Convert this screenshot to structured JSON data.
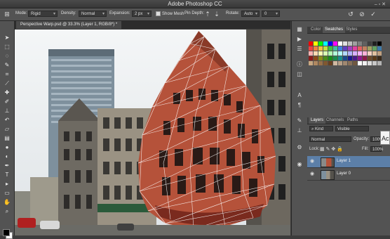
{
  "app": {
    "title": "Adobe Photoshop CC"
  },
  "options": {
    "mode_label": "Mode:",
    "mode_value": "Rigid",
    "density_label": "Density:",
    "density_value": "Normal",
    "expansion_label": "Expansion:",
    "expansion_value": "2 px",
    "show_mesh_label": "Show Mesh",
    "pin_depth_label": "Pin Depth:",
    "rotate_label": "Rotate:",
    "rotate_value": "Auto",
    "rotate_angle": "0"
  },
  "document": {
    "tab_label": "Perspective Warp.psd @ 33.3% (Layer 1, RGB/8*) *"
  },
  "swatches_panel": {
    "tabs": [
      "Color",
      "Swatches",
      "Styles"
    ],
    "active_tab": "Swatches",
    "colors": [
      "#ff0000",
      "#ffff00",
      "#00ff00",
      "#00ffff",
      "#0000ff",
      "#ff00ff",
      "#ffffff",
      "#e0e0e0",
      "#c0c0c0",
      "#a0a0a0",
      "#808080",
      "#606060",
      "#404040",
      "#202020",
      "#000000",
      "#f04040",
      "#f08040",
      "#f0c040",
      "#c0e040",
      "#40c040",
      "#40c0a0",
      "#4080e0",
      "#6040c0",
      "#a040c0",
      "#e040a0",
      "#e06060",
      "#c08060",
      "#a0a060",
      "#60a060",
      "#3d7aa8",
      "#ffb3b3",
      "#ffd9b3",
      "#ffffb3",
      "#d9ffb3",
      "#b3ffb3",
      "#b3ffd9",
      "#b3ffff",
      "#b3d9ff",
      "#b3b3ff",
      "#d9b3ff",
      "#ffb3ff",
      "#ffb3d9",
      "#f5d0c0",
      "#e0c0a0",
      "#c0a080",
      "#8c1a1a",
      "#8c4a1a",
      "#8c8c1a",
      "#4a8c1a",
      "#1a8c1a",
      "#1a8c4a",
      "#1a8c8c",
      "#1a4a8c",
      "#1a1a8c",
      "#4a1a8c",
      "#8c1a8c",
      "#8c1a4a",
      "#6b4a2a",
      "#5a3a1a",
      "#3a2a1a",
      "#c8a882",
      "#b08860",
      "#987048",
      "#805830",
      "#684020",
      "#d0b8a0",
      "#b8a088",
      "#a08870",
      "#887058",
      "#705840",
      "#ffffff",
      "#f0f0f0",
      "#dcdcdc",
      "#c8c8c8",
      "#b4b4b4"
    ]
  },
  "layers_panel": {
    "tabs": [
      "Layers",
      "Channels",
      "Paths"
    ],
    "active_tab": "Layers",
    "kind_filter": "Kind",
    "filter_value": "Visible",
    "blend_mode": "Normal",
    "opacity_label": "Opacity:",
    "opacity_value": "100%",
    "fill_label": "Fill:",
    "fill_value": "100%",
    "lock_label": "Lock:",
    "layers": [
      {
        "name": "Layer 1",
        "selected": true
      },
      {
        "name": "Layer 0",
        "selected": false
      }
    ]
  },
  "popout_text": "Ac",
  "colors": {
    "panel_bg": "#535353",
    "highlight": "#5c7fa8",
    "building_red": "#b5523a"
  }
}
